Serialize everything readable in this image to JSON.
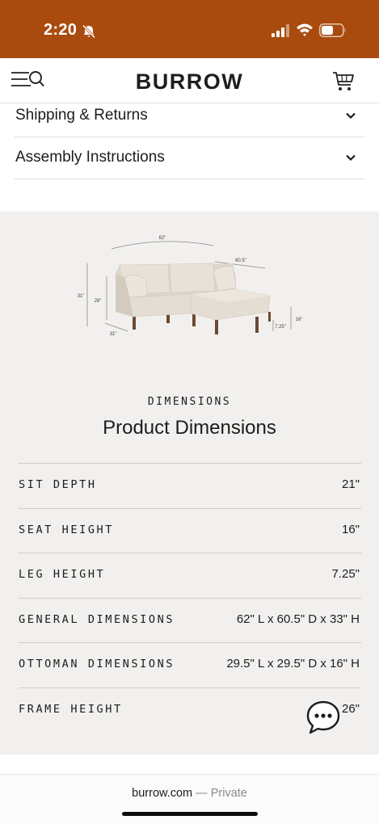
{
  "status_bar": {
    "time": "2:20",
    "bell_icon": "bell-slash-icon",
    "signal_icon": "cellular-signal-icon",
    "wifi_icon": "wifi-icon",
    "battery_icon": "battery-icon",
    "color": "#a94b0e"
  },
  "header": {
    "logo": "BURROW",
    "menu_icon": "menu-icon",
    "search_icon": "search-icon",
    "cart_icon": "cart-icon"
  },
  "accordion": [
    {
      "label": "Shipping & Returns"
    },
    {
      "label": "Assembly Instructions"
    }
  ],
  "dimensions": {
    "illustration_labels": {
      "width": "62\"",
      "ottoman_length": "60.5\"",
      "height": "31\"",
      "back_height": "28\"",
      "depth": "31\"",
      "ottoman_height": "16\"",
      "leg_height": "7.25\""
    },
    "eyebrow": "DIMENSIONS",
    "title": "Product Dimensions",
    "rows": [
      {
        "label": "SIT DEPTH",
        "value": "21\""
      },
      {
        "label": "SEAT HEIGHT",
        "value": "16\""
      },
      {
        "label": "LEG HEIGHT",
        "value": "7.25\""
      },
      {
        "label": "GENERAL DIMENSIONS",
        "value": "62\" L x 60.5\" D x 33\" H"
      },
      {
        "label": "OTTOMAN DIMENSIONS",
        "value": "29.5\" L x 29.5\" D x 16\" H"
      },
      {
        "label": "FRAME HEIGHT",
        "value": "26\""
      }
    ]
  },
  "chat": {
    "icon": "chat-bubble-icon"
  },
  "footer": {
    "domain": "burrow.com",
    "separator": " — ",
    "privacy": "Private"
  },
  "colors": {
    "accent": "#a94b0e",
    "section_bg": "#f2f0ee",
    "sofa_fabric": "#ddd6cc",
    "sofa_legs": "#6b4a34"
  }
}
